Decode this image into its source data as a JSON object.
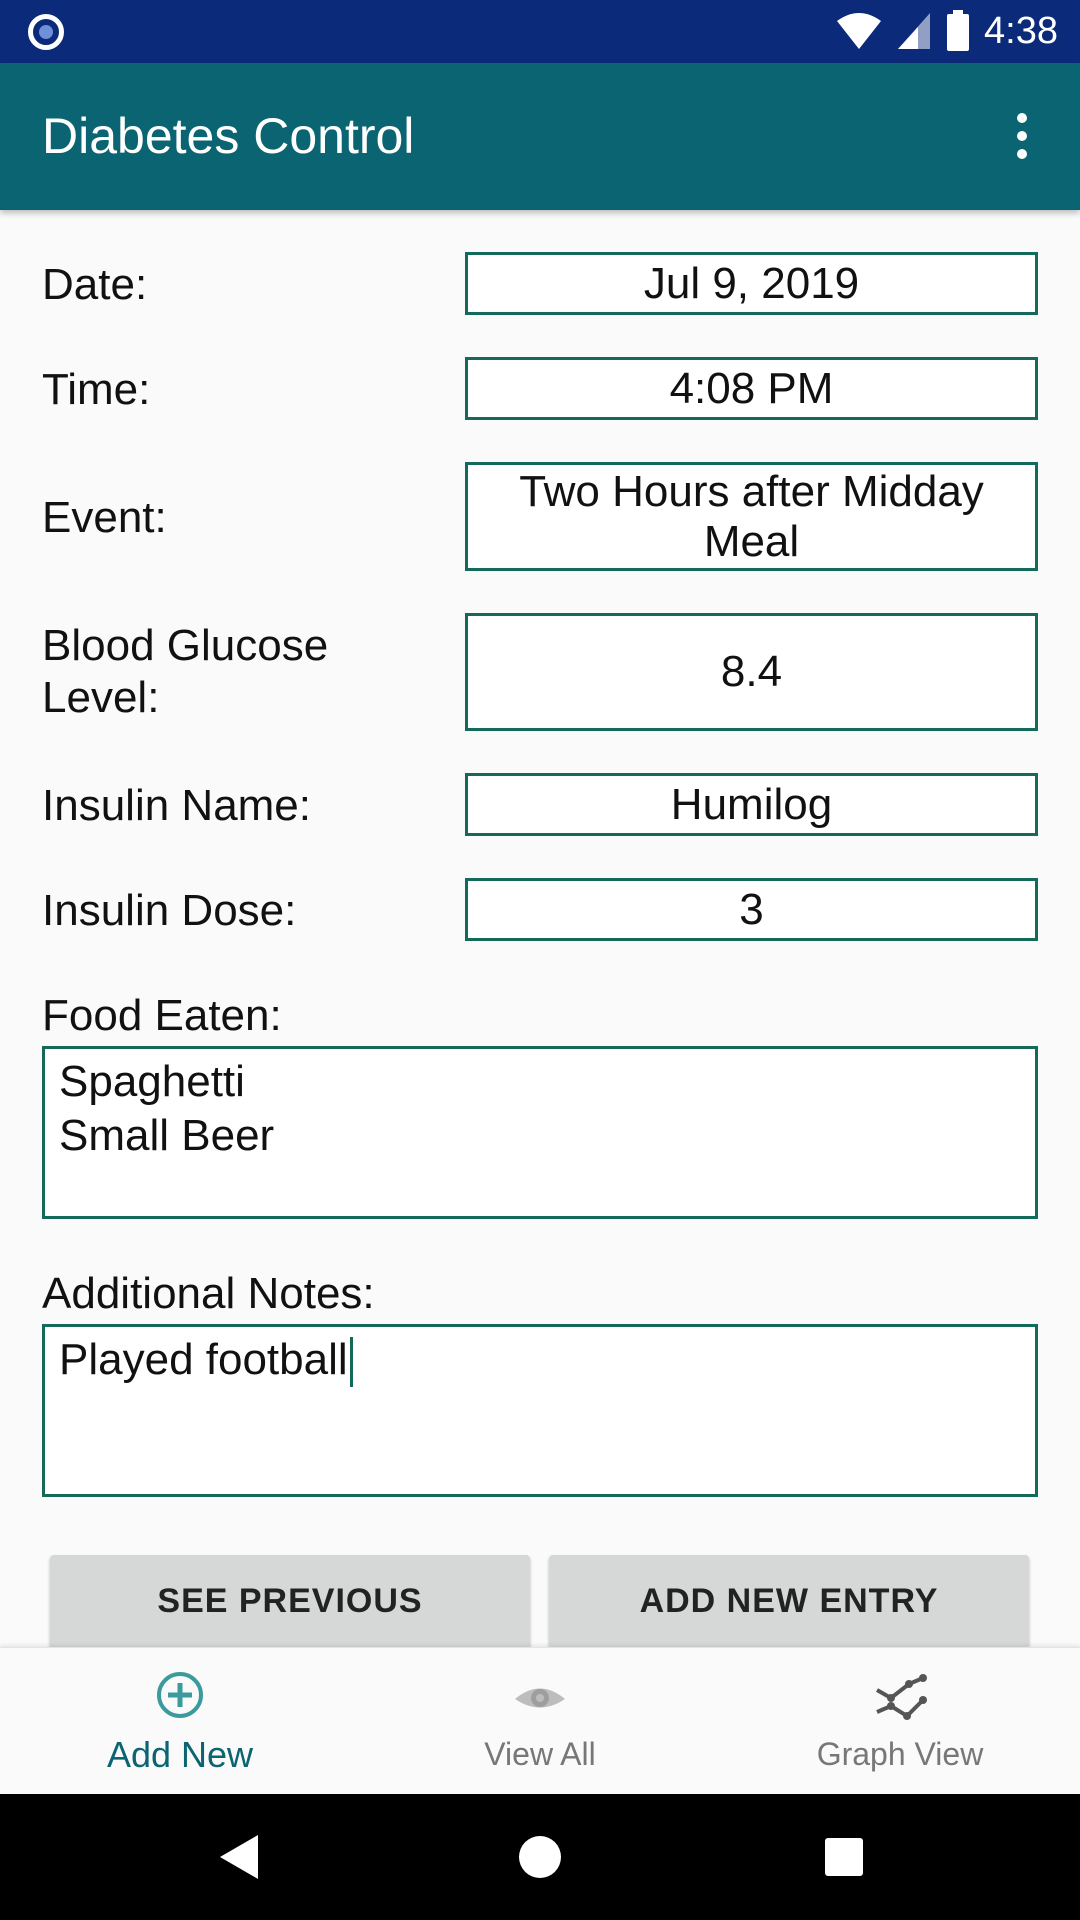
{
  "status_bar": {
    "time": "4:38",
    "icons": [
      "record-icon",
      "wifi-icon",
      "signal-icon",
      "battery-icon"
    ]
  },
  "app_bar": {
    "title": "Diabetes Control",
    "menu_icon": "more-vert-icon"
  },
  "form": {
    "date": {
      "label": "Date:",
      "value": "Jul 9, 2019"
    },
    "time": {
      "label": "Time:",
      "value": "4:08 PM"
    },
    "event": {
      "label": "Event:",
      "value": "Two Hours after Midday Meal"
    },
    "glucose": {
      "label": "Blood Glucose Level:",
      "value": "8.4"
    },
    "insulin_name": {
      "label": "Insulin Name:",
      "value": "Humilog"
    },
    "insulin_dose": {
      "label": "Insulin Dose:",
      "value": "3"
    },
    "food": {
      "label": "Food Eaten:",
      "value": "Spaghetti\nSmall Beer"
    },
    "notes": {
      "label": "Additional Notes:",
      "value": "Played football"
    }
  },
  "buttons": {
    "see_previous": "SEE PREVIOUS",
    "add_new_entry": "ADD NEW ENTRY"
  },
  "bottom_nav": {
    "items": [
      {
        "label": "Add New",
        "icon": "add-circle-icon",
        "active": true
      },
      {
        "label": "View All",
        "icon": "eye-icon",
        "active": false
      },
      {
        "label": "Graph View",
        "icon": "graph-icon",
        "active": false
      }
    ]
  },
  "colors": {
    "status_bar": "#0b2a7a",
    "app_bar": "#0a6472",
    "field_border": "#146a58",
    "accent": "#0a6472"
  }
}
